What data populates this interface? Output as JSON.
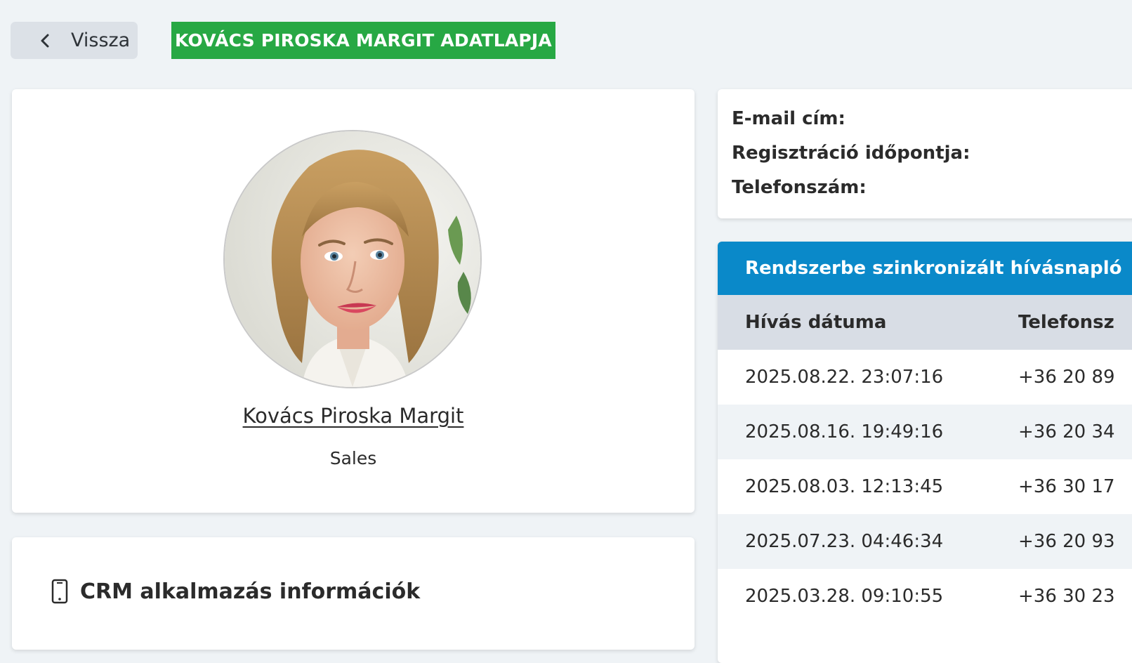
{
  "header": {
    "back_label": "Vissza",
    "page_title": "KOVÁCS PIROSKA MARGIT ADATLAPJA"
  },
  "profile": {
    "name": "Kovács Piroska Margit",
    "role": "Sales"
  },
  "crm": {
    "title": "CRM alkalmazás információk"
  },
  "info": {
    "email_label": "E-mail cím:",
    "registration_label": "Regisztráció időpontja:",
    "phone_label": "Telefonszám:"
  },
  "calls": {
    "title": "Rendszerbe szinkronizált hívásnapló",
    "columns": [
      "Hívás dátuma",
      "Telefonsz"
    ],
    "rows": [
      {
        "date": "2025.08.22. 23:07:16",
        "phone": "+36 20 89"
      },
      {
        "date": "2025.08.16. 19:49:16",
        "phone": "+36 20 34"
      },
      {
        "date": "2025.08.03. 12:13:45",
        "phone": "+36 30 17"
      },
      {
        "date": "2025.07.23. 04:46:34",
        "phone": "+36 20 93"
      },
      {
        "date": "2025.03.28. 09:10:55",
        "phone": "+36 30 23"
      }
    ]
  },
  "colors": {
    "background": "#eff3f6",
    "title_green": "#27a844",
    "calls_header_blue": "#0a89c9",
    "table_head_gray": "#d8dde5"
  }
}
